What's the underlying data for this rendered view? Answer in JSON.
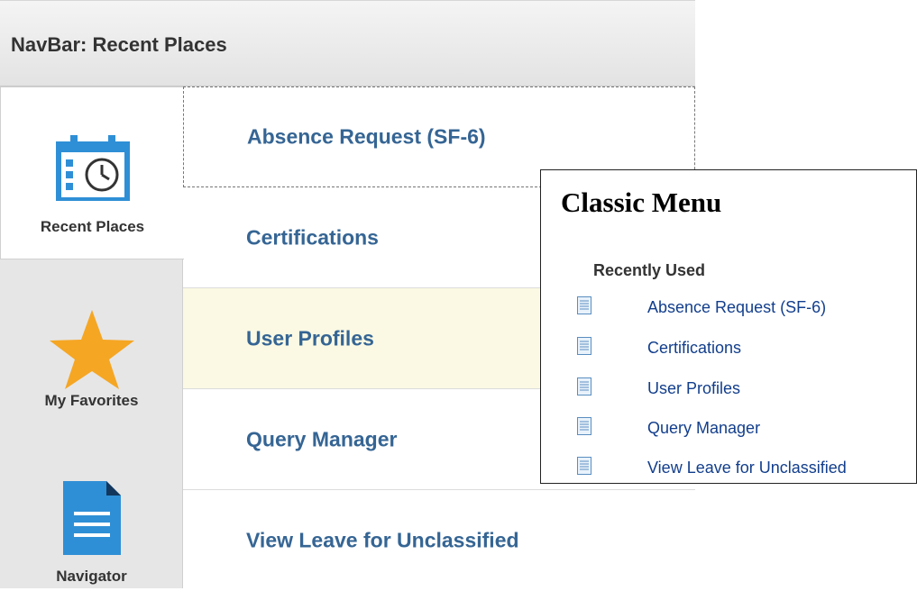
{
  "header": {
    "title": "NavBar: Recent Places"
  },
  "sidebar": {
    "items": [
      {
        "label": "Recent Places",
        "icon": "calendar-clock-icon"
      },
      {
        "label": "My Favorites",
        "icon": "star-icon"
      },
      {
        "label": "Navigator",
        "icon": "document-icon"
      }
    ]
  },
  "recent_list": {
    "items": [
      {
        "label": "Absence Request (SF-6)"
      },
      {
        "label": "Certifications"
      },
      {
        "label": "User Profiles"
      },
      {
        "label": "Query Manager"
      },
      {
        "label": "View Leave for Unclassified"
      }
    ]
  },
  "classic_menu": {
    "title": "Classic Menu",
    "section_label": "Recently Used",
    "items": [
      {
        "label": "Absence Request (SF-6)",
        "icon": "document-icon"
      },
      {
        "label": "Certifications",
        "icon": "document-icon"
      },
      {
        "label": "User Profiles",
        "icon": "document-icon"
      },
      {
        "label": "Query Manager",
        "icon": "document-icon"
      },
      {
        "label": "View Leave for Unclassified",
        "icon": "document-icon"
      }
    ]
  },
  "colors": {
    "link": "#356594",
    "classic_link": "#123e8c",
    "hover_row": "#fbf9e3",
    "icon_blue": "#2f8fd6",
    "star": "#f5a623"
  }
}
